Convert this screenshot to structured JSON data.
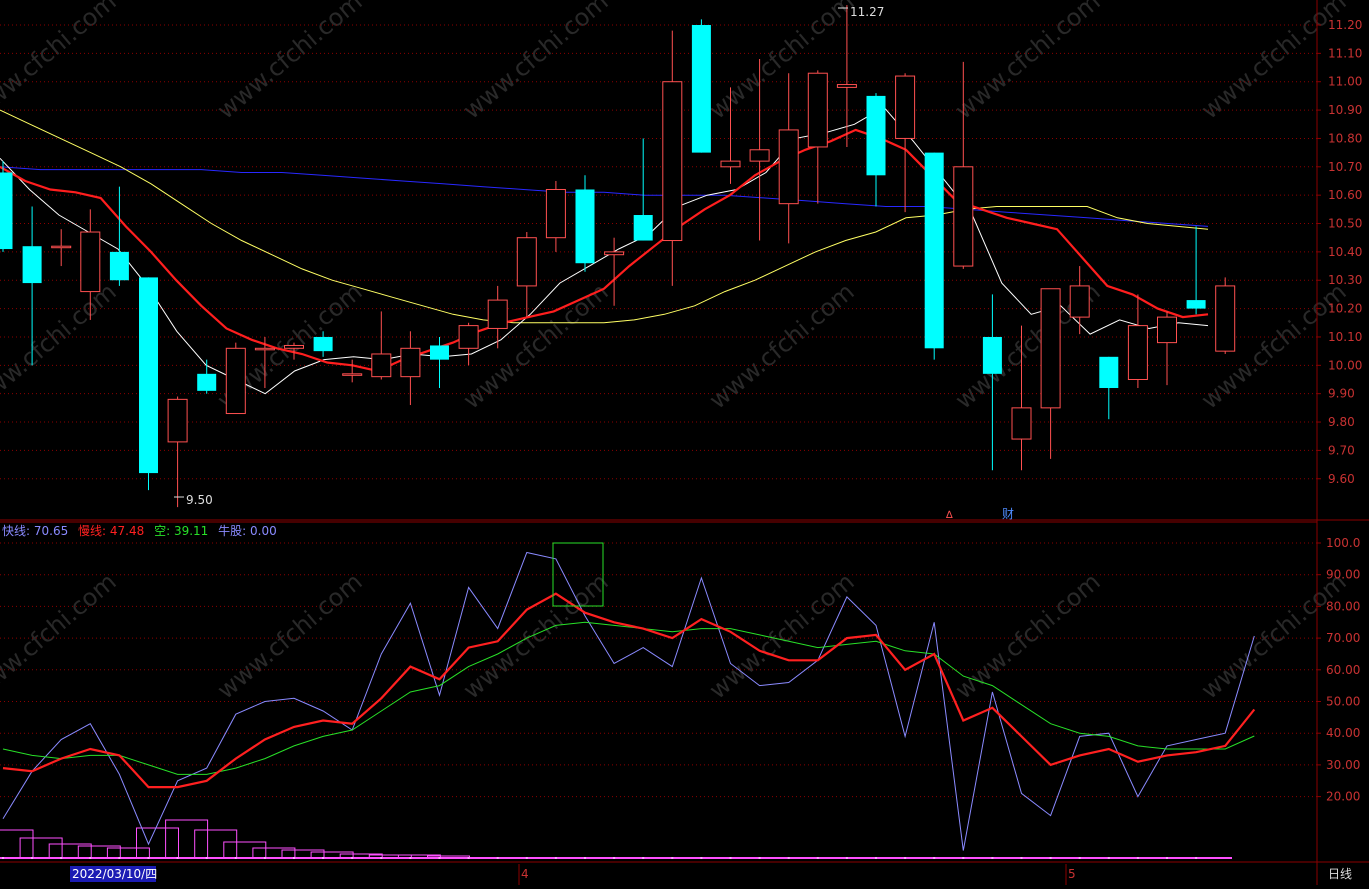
{
  "colors": {
    "background": "#000000",
    "frame": "#8b0000",
    "axis_text": "#c83232",
    "up_candle": "#ff5050",
    "down_candle": "#00ffff",
    "ma5": "#ffffff",
    "ma10": "#ff1e1e",
    "ma20": "#ffff64",
    "ma60": "#2828ff",
    "fast": "#8a8aff",
    "slow": "#ff2020",
    "kong": "#28e028",
    "niu": "#ff50ff",
    "watermark": "#5a5a5a",
    "date_highlight": "#1c1cb4"
  },
  "watermark_text": "www.cfchi.com",
  "price_panel": {
    "y_ticks": [
      "11.20",
      "11.10",
      "11.00",
      "10.90",
      "10.80",
      "10.70",
      "10.60",
      "10.50",
      "10.40",
      "10.30",
      "10.20",
      "10.10",
      "10.00",
      "9.90",
      "9.80",
      "9.70",
      "9.60"
    ],
    "high_label": "11.27",
    "low_label": "9.50",
    "marker_symbol": "∆",
    "marker_cai": "财"
  },
  "indicator_panel": {
    "legend": {
      "fast_label": "快线: 70.65",
      "slow_label": "慢线: 47.48",
      "kong_label": "空: 39.11",
      "niu_label": "牛股: 0.00"
    },
    "y_ticks": [
      "100.0",
      "90.00",
      "80.00",
      "70.00",
      "60.00",
      "50.00",
      "40.00",
      "30.00",
      "20.00"
    ]
  },
  "x_axis": {
    "date_label": "2022/03/10/四",
    "month_label_1": "4",
    "month_label_2": "5",
    "period_label": "日线"
  },
  "chart_data": [
    {
      "type": "candlestick",
      "title": "",
      "ylim": [
        9.5,
        11.27
      ],
      "high_marker": 11.27,
      "low_marker": 9.5,
      "candles": [
        {
          "o": 10.68,
          "h": 10.72,
          "l": 10.4,
          "c": 10.41
        },
        {
          "o": 10.42,
          "h": 10.56,
          "l": 10.0,
          "c": 10.29
        },
        {
          "o": 10.42,
          "h": 10.48,
          "l": 10.35,
          "c": 10.42
        },
        {
          "o": 10.26,
          "h": 10.55,
          "l": 10.16,
          "c": 10.47
        },
        {
          "o": 10.4,
          "h": 10.63,
          "l": 10.28,
          "c": 10.3
        },
        {
          "o": 10.31,
          "h": 10.31,
          "l": 9.56,
          "c": 9.62
        },
        {
          "o": 9.73,
          "h": 9.89,
          "l": 9.5,
          "c": 9.88
        },
        {
          "o": 9.97,
          "h": 10.02,
          "l": 9.9,
          "c": 9.91
        },
        {
          "o": 9.83,
          "h": 10.08,
          "l": 9.83,
          "c": 10.06
        },
        {
          "o": 10.06,
          "h": 10.1,
          "l": 9.92,
          "c": 10.06
        },
        {
          "o": 10.06,
          "h": 10.08,
          "l": 10.02,
          "c": 10.07
        },
        {
          "o": 10.1,
          "h": 10.12,
          "l": 10.03,
          "c": 10.05
        },
        {
          "o": 9.97,
          "h": 10.02,
          "l": 9.94,
          "c": 9.97
        },
        {
          "o": 9.96,
          "h": 10.19,
          "l": 9.95,
          "c": 10.04
        },
        {
          "o": 9.96,
          "h": 10.12,
          "l": 9.86,
          "c": 10.06
        },
        {
          "o": 10.07,
          "h": 10.1,
          "l": 9.92,
          "c": 10.02
        },
        {
          "o": 10.06,
          "h": 10.15,
          "l": 10.0,
          "c": 10.14
        },
        {
          "o": 10.13,
          "h": 10.28,
          "l": 10.06,
          "c": 10.23
        },
        {
          "o": 10.28,
          "h": 10.47,
          "l": 10.17,
          "c": 10.45
        },
        {
          "o": 10.45,
          "h": 10.65,
          "l": 10.4,
          "c": 10.62
        },
        {
          "o": 10.62,
          "h": 10.67,
          "l": 10.33,
          "c": 10.36
        },
        {
          "o": 10.39,
          "h": 10.45,
          "l": 10.21,
          "c": 10.4
        },
        {
          "o": 10.53,
          "h": 10.8,
          "l": 10.44,
          "c": 10.44
        },
        {
          "o": 10.44,
          "h": 11.18,
          "l": 10.28,
          "c": 11.0
        },
        {
          "o": 11.2,
          "h": 11.22,
          "l": 10.75,
          "c": 10.75
        },
        {
          "o": 10.7,
          "h": 10.98,
          "l": 10.64,
          "c": 10.72
        },
        {
          "o": 10.72,
          "h": 11.08,
          "l": 10.44,
          "c": 10.76
        },
        {
          "o": 10.57,
          "h": 11.03,
          "l": 10.43,
          "c": 10.83
        },
        {
          "o": 10.77,
          "h": 11.04,
          "l": 10.57,
          "c": 11.03
        },
        {
          "o": 10.98,
          "h": 11.27,
          "l": 10.77,
          "c": 10.99
        },
        {
          "o": 10.95,
          "h": 10.96,
          "l": 10.56,
          "c": 10.67
        },
        {
          "o": 10.8,
          "h": 11.03,
          "l": 10.54,
          "c": 11.02
        },
        {
          "o": 10.75,
          "h": 10.75,
          "l": 10.02,
          "c": 10.06
        },
        {
          "o": 10.35,
          "h": 11.07,
          "l": 10.34,
          "c": 10.7
        },
        {
          "o": 10.1,
          "h": 10.25,
          "l": 9.63,
          "c": 9.97
        },
        {
          "o": 9.74,
          "h": 10.14,
          "l": 9.63,
          "c": 9.85
        },
        {
          "o": 9.85,
          "h": 10.27,
          "l": 9.67,
          "c": 10.27
        },
        {
          "o": 10.17,
          "h": 10.35,
          "l": 10.11,
          "c": 10.28
        },
        {
          "o": 10.03,
          "h": 10.03,
          "l": 9.81,
          "c": 9.92
        },
        {
          "o": 9.95,
          "h": 10.25,
          "l": 9.92,
          "c": 10.14
        },
        {
          "o": 10.08,
          "h": 10.19,
          "l": 9.93,
          "c": 10.17
        },
        {
          "o": 10.23,
          "h": 10.49,
          "l": 10.18,
          "c": 10.2
        },
        {
          "o": 10.05,
          "h": 10.31,
          "l": 10.04,
          "c": 10.28
        }
      ],
      "series": [
        {
          "values": [
            10.73,
            10.62,
            10.53,
            10.47,
            10.41,
            10.28,
            10.12,
            10.0,
            9.95,
            9.9,
            9.98,
            10.02,
            10.03,
            10.02,
            10.04,
            10.03,
            10.04,
            10.09,
            10.18,
            10.29,
            10.35,
            10.41,
            10.46,
            10.56,
            10.6,
            10.62,
            10.68,
            10.8,
            10.82,
            10.85,
            10.91,
            10.79,
            10.66,
            10.53,
            10.29,
            10.18,
            10.21,
            10.11,
            10.16,
            10.13,
            10.15,
            10.14
          ]
        },
        {
          "values": [
            10.7,
            10.65,
            10.62,
            10.61,
            10.59,
            10.49,
            10.4,
            10.3,
            10.21,
            10.13,
            10.09,
            10.06,
            10.04,
            10.01,
            10.0,
            9.98,
            10.02,
            10.05,
            10.08,
            10.12,
            10.15,
            10.17,
            10.19,
            10.23,
            10.27,
            10.35,
            10.42,
            10.49,
            10.55,
            10.6,
            10.67,
            10.72,
            10.76,
            10.79,
            10.83,
            10.8,
            10.76,
            10.67,
            10.58,
            10.55,
            10.52,
            10.5,
            10.48,
            10.38,
            10.28,
            10.25,
            10.2,
            10.17,
            10.18
          ]
        },
        {
          "values": [
            10.9,
            10.85,
            10.8,
            10.75,
            10.7,
            10.64,
            10.57,
            10.5,
            10.44,
            10.39,
            10.34,
            10.3,
            10.27,
            10.24,
            10.21,
            10.18,
            10.16,
            10.15,
            10.15,
            10.15,
            10.15,
            10.16,
            10.18,
            10.21,
            10.26,
            10.3,
            10.35,
            10.4,
            10.44,
            10.47,
            10.52,
            10.53,
            10.55,
            10.56,
            10.56,
            10.56,
            10.56,
            10.52,
            10.5,
            10.49,
            10.48
          ]
        },
        {
          "values": [
            10.7,
            10.69,
            10.69,
            10.69,
            10.69,
            10.69,
            10.68,
            10.68,
            10.67,
            10.66,
            10.65,
            10.64,
            10.63,
            10.62,
            10.61,
            10.61,
            10.6,
            10.6,
            10.6,
            10.59,
            10.58,
            10.57,
            10.56,
            10.56,
            10.55,
            10.54,
            10.53,
            10.52,
            10.51,
            10.5,
            10.49
          ]
        }
      ]
    },
    {
      "type": "line",
      "title": "",
      "ylim": [
        0,
        105
      ],
      "series": [
        {
          "name": "快线",
          "values": [
            13,
            28,
            38,
            43,
            27,
            5,
            25,
            29,
            46,
            50,
            51,
            47,
            41,
            65,
            81,
            52,
            86,
            73,
            97,
            95,
            77,
            62,
            67,
            61,
            89,
            62,
            55,
            56,
            63,
            83,
            74,
            39,
            75,
            3,
            53,
            21,
            14,
            39,
            40,
            20,
            36,
            38,
            40,
            70.65
          ]
        },
        {
          "name": "慢线",
          "values": [
            29,
            28,
            32,
            35,
            33,
            23,
            23,
            25,
            32,
            38,
            42,
            44,
            43,
            51,
            61,
            57,
            67,
            69,
            79,
            84,
            78,
            75,
            73,
            70,
            76,
            72,
            66,
            63,
            63,
            70,
            71,
            60,
            65,
            44,
            48,
            39,
            30,
            33,
            35,
            31,
            33,
            34,
            36,
            47.48
          ]
        },
        {
          "name": "空",
          "values": [
            35,
            33,
            32,
            33,
            33,
            30,
            27,
            27,
            29,
            32,
            36,
            39,
            41,
            47,
            53,
            55,
            61,
            65,
            70,
            74,
            75,
            74,
            73,
            72,
            73,
            73,
            71,
            69,
            67,
            68,
            69,
            66,
            65,
            58,
            55,
            49,
            43,
            40,
            39,
            36,
            35,
            35,
            35,
            39.11
          ]
        },
        {
          "name": "牛股",
          "values": [
            0.0
          ]
        }
      ]
    }
  ]
}
